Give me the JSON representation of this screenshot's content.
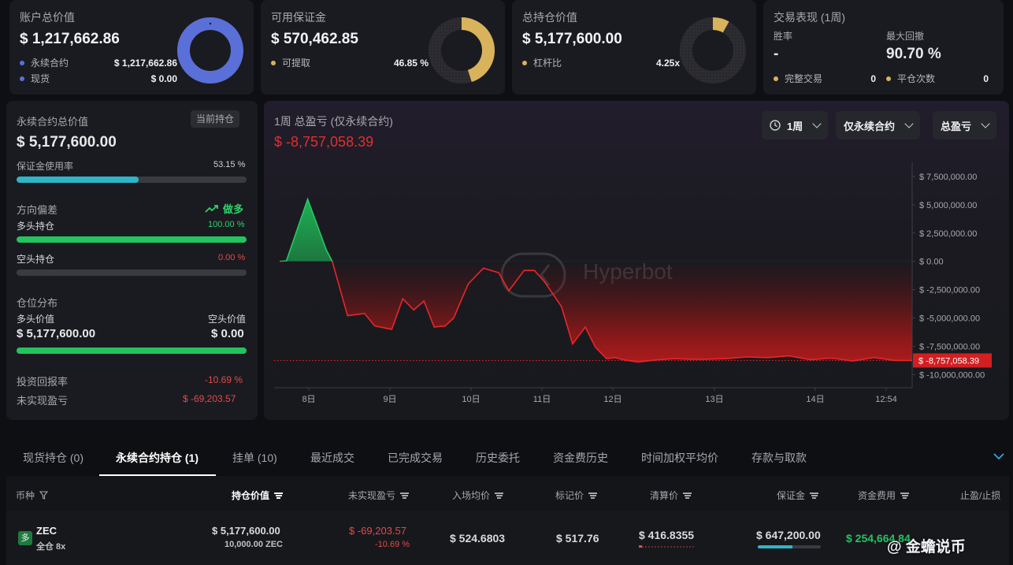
{
  "stats": {
    "account": {
      "title": "账户总价值",
      "value": "$ 1,217,662.86",
      "legend": [
        {
          "label": "永续合约",
          "value": "$ 1,217,662.86",
          "color": "#5b6fd8"
        },
        {
          "label": "现货",
          "value": "$ 0.00",
          "color": "#5b6fd8"
        }
      ],
      "ring_fraction": 1.0,
      "ring_color": "#5b6fd8"
    },
    "margin": {
      "title": "可用保证金",
      "value": "$ 570,462.85",
      "legend": [
        {
          "label": "可提取",
          "value": "46.85 %",
          "color": "#d9b25c"
        }
      ],
      "ring_fraction": 0.4685,
      "ring_color": "#d9b25c"
    },
    "position": {
      "title": "总持仓价值",
      "value": "$ 5,177,600.00",
      "legend": [
        {
          "label": "杠杆比",
          "value": "4.25x",
          "color": "#d9b25c"
        }
      ],
      "ring_fraction": 0.1,
      "ring_color": "#d9b25c"
    },
    "performance": {
      "title": "交易表现 (1周)",
      "winrate_label": "胜率",
      "winrate_value": "-",
      "drawdown_label": "最大回撤",
      "drawdown_value": "90.70 %",
      "completed_label": "完整交易",
      "completed_value": "0",
      "close_label": "平仓次数",
      "close_value": "0",
      "dot_color": "#d9b25c"
    }
  },
  "perp": {
    "title": "永续合约总价值",
    "badge": "当前持仓",
    "value": "$ 5,177,600.00",
    "margin_usage_label": "保证金使用率",
    "margin_usage_value": "53.15 %",
    "margin_usage_fraction": 0.5315,
    "direction_label": "方向偏差",
    "direction_value": "做多",
    "long_label": "多头持仓",
    "long_value": "100.00 %",
    "long_fraction": 1.0,
    "short_label": "空头持仓",
    "short_value": "0.00 %",
    "short_fraction": 0.0,
    "dist_label": "仓位分布",
    "long_val_label": "多头价值",
    "short_val_label": "空头价值",
    "long_val": "$ 5,177,600.00",
    "short_val": "$ 0.00",
    "roi_label": "投资回报率",
    "roi_value": "-10.69 %",
    "upnl_label": "未实现盈亏",
    "upnl_value": "$ -69,203.57"
  },
  "chart_panel": {
    "title": "1周 总盈亏 (仅永续合约)",
    "value": "$ -8,757,058.39",
    "dropdown_period": "1周",
    "dropdown_scope": "仅永续合约",
    "dropdown_metric": "总盈亏",
    "watermark": "Hyperbot",
    "current_label": "$ -8,757,058.39"
  },
  "chart_data": {
    "type": "area",
    "x_ticks": [
      "8日",
      "9日",
      "10日",
      "11日",
      "12日",
      "13日",
      "14日",
      "12:54"
    ],
    "y_ticks": [
      "$ 7,500,000.00",
      "$ 5,000,000.00",
      "$ 2,500,000.00",
      "$ 0.00",
      "$ -2,500,000.00",
      "$ -5,000,000.00",
      "$ -7,500,000.00",
      "$ -10,000,000.00"
    ],
    "ylim": [
      -10000000,
      7500000
    ],
    "x": [
      0,
      0.08,
      0.33,
      0.55,
      0.62,
      0.8,
      1.0,
      1.12,
      1.32,
      1.45,
      1.58,
      1.7,
      1.82,
      1.95,
      2.05,
      2.22,
      2.4,
      2.58,
      2.7,
      2.88,
      3.0,
      3.12,
      3.32,
      3.45,
      3.6,
      3.72,
      3.85,
      3.95,
      4.05,
      4.22,
      4.45,
      4.65,
      4.85,
      5.0,
      5.25,
      5.5,
      5.75,
      6.0,
      6.25,
      6.5,
      6.75,
      7.0,
      7.25,
      7.45
    ],
    "values": [
      0,
      50000,
      5500000,
      1000000,
      0,
      -4800000,
      -4600000,
      -5700000,
      -6000000,
      -3300000,
      -4300000,
      -3500000,
      -5800000,
      -5700000,
      -5000000,
      -2000000,
      -600000,
      -1000000,
      -2600000,
      -800000,
      -800000,
      -1800000,
      -4000000,
      -7300000,
      -5800000,
      -7600000,
      -8600000,
      -8500000,
      -8700000,
      -8900000,
      -8700000,
      -8600000,
      -8650000,
      -8650000,
      -8600000,
      -8450000,
      -8500000,
      -8350000,
      -8700000,
      -8550000,
      -8800000,
      -8500000,
      -8750000,
      -8757058
    ]
  },
  "tabs": [
    {
      "label": "现货持仓 (0)",
      "active": false
    },
    {
      "label": "永续合约持仓 (1)",
      "active": true
    },
    {
      "label": "挂单 (10)",
      "active": false
    },
    {
      "label": "最近成交",
      "active": false
    },
    {
      "label": "已完成交易",
      "active": false
    },
    {
      "label": "历史委托",
      "active": false
    },
    {
      "label": "资金费历史",
      "active": false
    },
    {
      "label": "时间加权平均价",
      "active": false
    },
    {
      "label": "存款与取款",
      "active": false
    }
  ],
  "table": {
    "headers": {
      "coin": "币种",
      "value": "持仓价值",
      "upnl": "未实现盈亏",
      "entry": "入场均价",
      "mark": "标记价",
      "liq": "清算价",
      "margin": "保证金",
      "funding": "资金费用",
      "tpsl": "止盈/止损"
    },
    "row": {
      "coin": "ZEC",
      "coin_badge": "多",
      "mode": "全仓 8x",
      "value": "$ 5,177,600.00",
      "qty": "10,000.00 ZEC",
      "upnl": "$ -69,203.57",
      "upnl_pct": "-10.69 %",
      "entry": "$ 524.6803",
      "mark": "$ 517.76",
      "liq": "$ 416.8355",
      "margin": "$ 647,200.00",
      "funding": "$ 254,664.84"
    }
  },
  "watermark_brand": "@ 金蟾说币"
}
